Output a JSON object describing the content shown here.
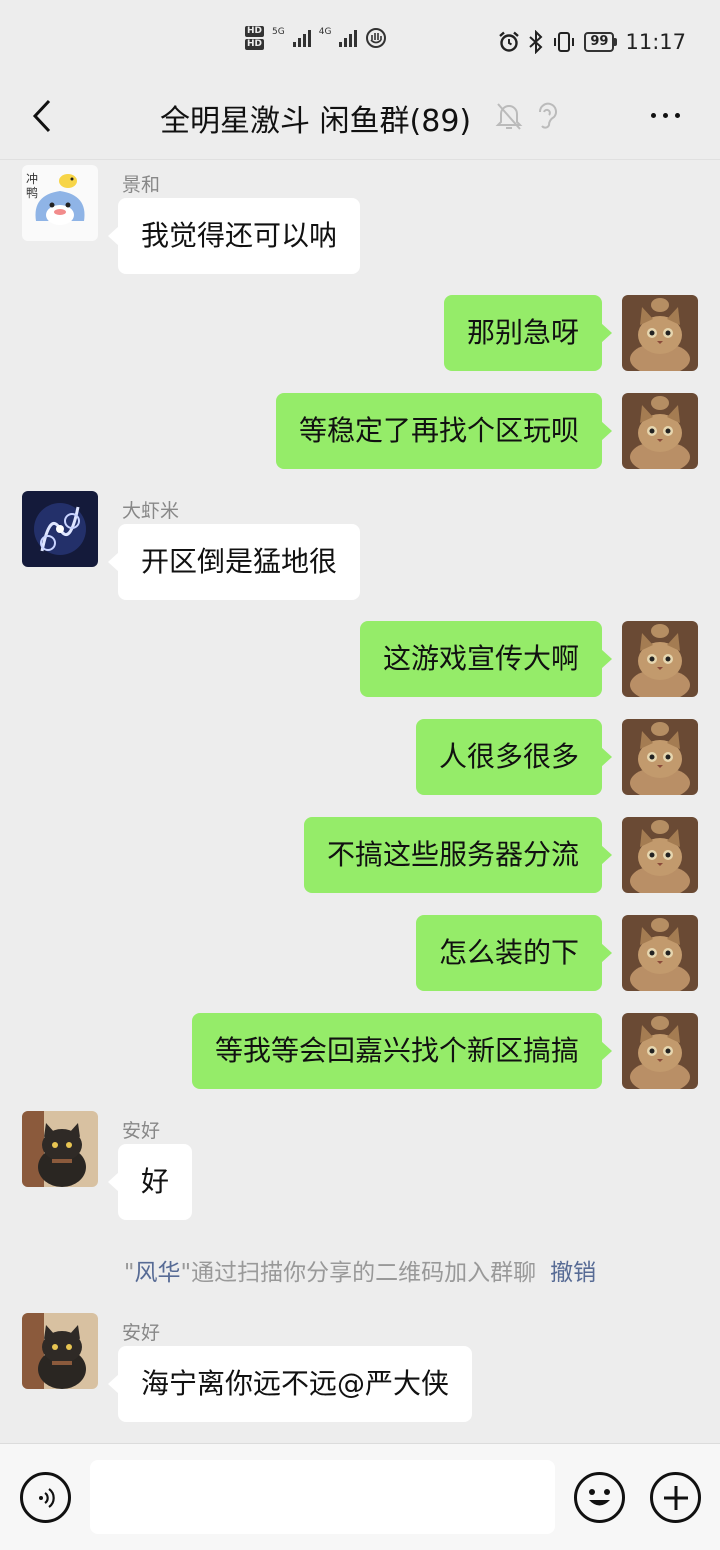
{
  "status_bar": {
    "hd1": "HD",
    "hd2": "HD",
    "net1": "5G",
    "net2": "4G",
    "battery": "99",
    "time": "11:17"
  },
  "nav": {
    "title": "全明星激斗 闲鱼群(89)"
  },
  "messages": [
    {
      "sender": "景和",
      "text": "我觉得还可以呐"
    },
    {
      "text": "那别急呀"
    },
    {
      "text": "等稳定了再找个区玩呗"
    },
    {
      "sender": "大虾米",
      "text": "开区倒是猛地很"
    },
    {
      "text": "这游戏宣传大啊"
    },
    {
      "text": "人很多很多"
    },
    {
      "text": "不搞这些服务器分流"
    },
    {
      "text": "怎么装的下"
    },
    {
      "text": "等我等会回嘉兴找个新区搞搞"
    },
    {
      "sender": "安好",
      "text": "好"
    },
    {
      "sender": "安好",
      "text": "海宁离你远不远@严大侠"
    }
  ],
  "system": {
    "quote_open": "\"",
    "name": "风华",
    "quote_close": "\"",
    "text": "通过扫描你分享的二维码加入群聊",
    "action": "撤销"
  },
  "input": {
    "value": ""
  },
  "colors": {
    "background": "#ededed",
    "outgoing_bubble": "#95ec69",
    "incoming_bubble": "#ffffff",
    "link": "#576b95"
  },
  "icons": [
    "back-arrow-icon",
    "mute-bell-icon",
    "ear-icon",
    "more-icon",
    "voice-icon",
    "emoji-icon",
    "plus-icon"
  ]
}
